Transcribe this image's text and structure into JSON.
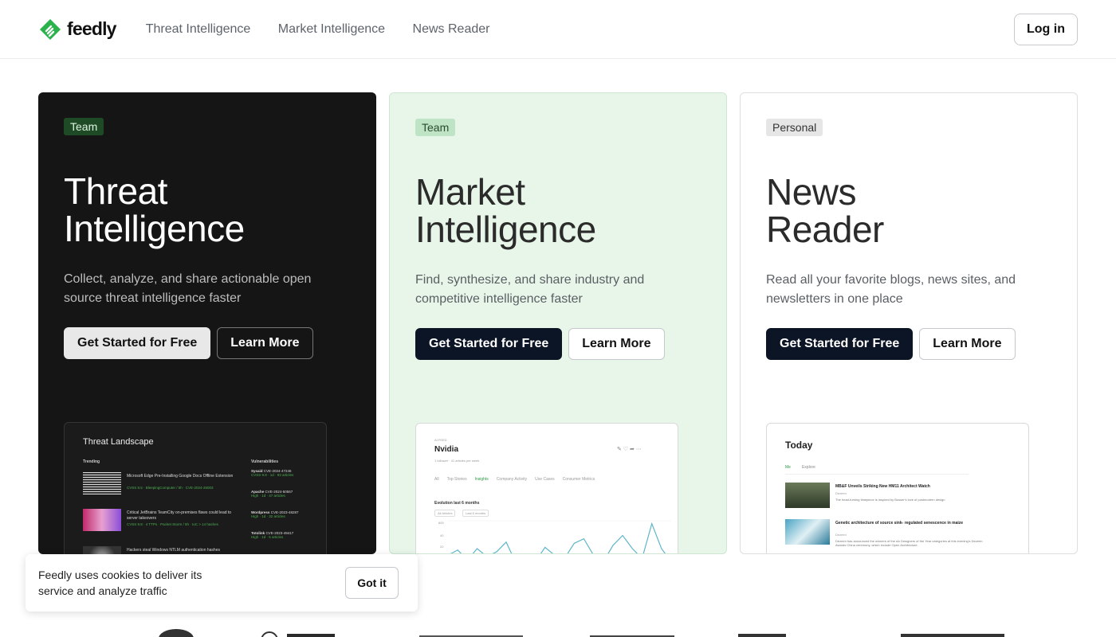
{
  "header": {
    "brand": "feedly",
    "nav": [
      "Threat Intelligence",
      "Market Intelligence",
      "News Reader"
    ],
    "login": "Log in"
  },
  "cards": [
    {
      "badge": "Team",
      "title_line1": "Threat",
      "title_line2": "Intelligence",
      "desc": "Collect, analyze, and share actionable open source threat intelligence faster",
      "primary": "Get Started for Free",
      "secondary": "Learn More",
      "preview": {
        "title": "Threat Landscape",
        "trending": "Trending",
        "vulnerabilities": "Vulnerabilities",
        "items": [
          {
            "text": "Microsoft Edge Pre-Installing Google Docs Offline Extension",
            "meta": "CVSS 8.5 · BleepingComputer / 5h · CVE-2024-26003"
          },
          {
            "text": "Critical JetBrains TeamCity on-premises flaws could lead to server takeovers",
            "meta": "CVSS 9.8 · 4 TTPs · Packet Storm / 5h · IoC > 14 hashes"
          },
          {
            "text": "Hackers steal Windows NTLM authentication hashes",
            "meta": ""
          }
        ],
        "vulns": [
          {
            "vendor": "Sysaid",
            "cve": "CVE-2024-47246",
            "meta": "CVSS 9.8 · 1d · 93 articles"
          },
          {
            "vendor": "Apache",
            "cve": "CVE-2024-50567",
            "meta": "High · 1d · 47 articles"
          },
          {
            "vendor": "Wordpress",
            "cve": "CVE-2023-48287",
            "meta": "High · 1d · 32 articles"
          },
          {
            "vendor": "Totolink",
            "cve": "CVE-2023-49417",
            "meta": "High · 1d · 5 articles"
          }
        ]
      }
    },
    {
      "badge": "Team",
      "title_line1": "Market",
      "title_line2": "Intelligence",
      "desc": "Find, synthesize, and share industry and competitive intelligence faster",
      "primary": "Get Started for Free",
      "secondary": "Learn More",
      "preview": {
        "kicker": "AI FEED",
        "title": "Nvidia",
        "followers": "1 follower · 41 articles per week",
        "tabs": [
          "All",
          "Top Stories",
          "Insights",
          "Company Activity",
          "Use Cases",
          "Consumer Metrics"
        ],
        "evolution": "Evolution last 6 months",
        "filter1": "All Articles",
        "filter2": "Last 6 months",
        "y_labels": [
          "600",
          "40",
          "20"
        ]
      }
    },
    {
      "badge": "Personal",
      "title_line1": "News",
      "title_line2": "Reader",
      "desc": "Read all your favorite blogs, news sites, and newsletters in one place",
      "primary": "Get Started for Free",
      "secondary": "Learn More",
      "preview": {
        "title": "Today",
        "tabs": [
          "Me",
          "Explore"
        ],
        "items": [
          {
            "headline": "MB&F Unveils Striking New HM11 Architect Watch",
            "source": "Dezeen",
            "body": "The head-turning timepiece is inspired by Busser's love of postmodern design"
          },
          {
            "headline": "Genetic architecture of source sink- regulated senescence in maize",
            "source": "Dezeen",
            "body": "Dezeen has announced the winners of the six Designers of the Year categories at this evening's Dezeen Awards China ceremony, which include Open Architecture."
          }
        ]
      }
    }
  ],
  "cookie": {
    "text": "Feedly uses cookies to deliver its service and analyze traffic",
    "button": "Got it"
  },
  "colors": {
    "brand_green": "#2bb24c",
    "dark_card": "#151515",
    "mint_card": "#e8f6ea",
    "primary_button": "#0c1526"
  },
  "market_chart_data": {
    "type": "line",
    "values": [
      30,
      38,
      22,
      40,
      28,
      35,
      50,
      18,
      30,
      20,
      42,
      30,
      25,
      48,
      55,
      30,
      20,
      45,
      60,
      40,
      25,
      78,
      40,
      20
    ]
  }
}
